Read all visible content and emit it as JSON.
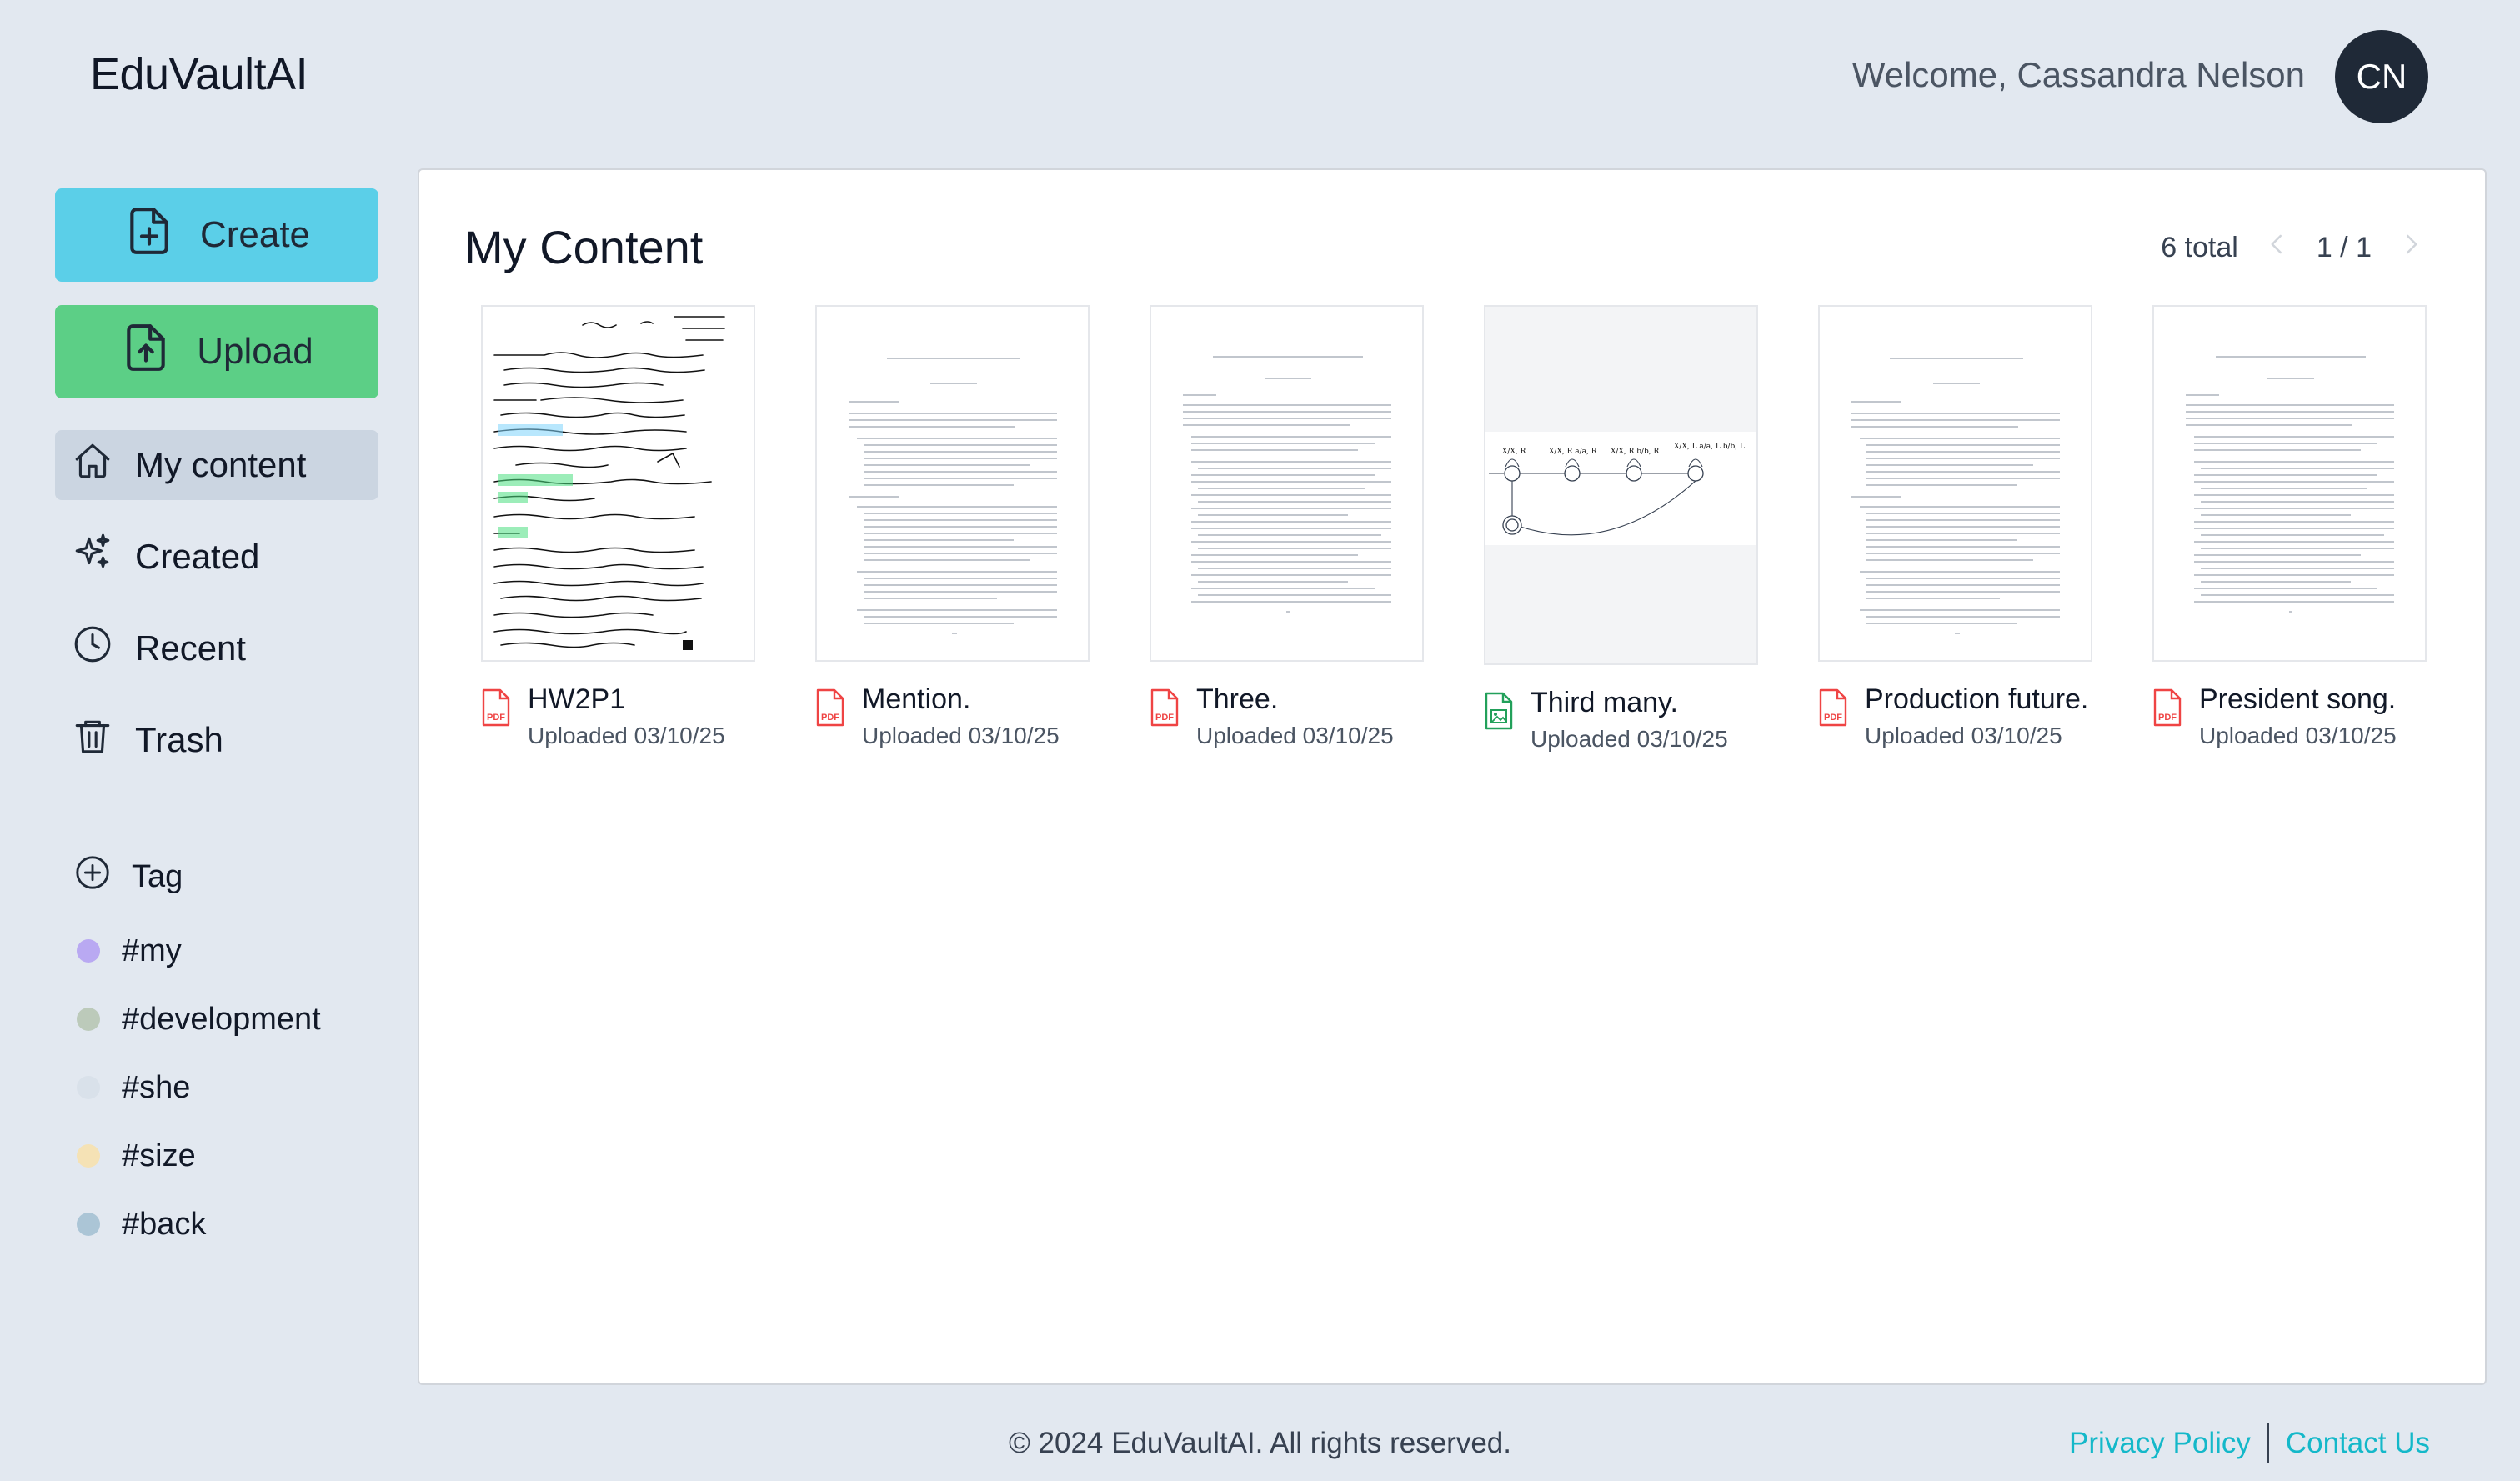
{
  "header": {
    "brand": "EduVaultAI",
    "welcome": "Welcome, Cassandra Nelson",
    "avatar_initials": "CN"
  },
  "sidebar": {
    "create_label": "Create",
    "upload_label": "Upload",
    "nav": [
      {
        "label": "My content",
        "icon": "home-icon",
        "active": true
      },
      {
        "label": "Created",
        "icon": "sparkles-icon",
        "active": false
      },
      {
        "label": "Recent",
        "icon": "clock-icon",
        "active": false
      },
      {
        "label": "Trash",
        "icon": "trash-icon",
        "active": false
      }
    ],
    "tag_header": "Tag",
    "tags": [
      {
        "label": "#my",
        "color": "#b9a9f2"
      },
      {
        "label": "#development",
        "color": "#bccaba"
      },
      {
        "label": "#she",
        "color": "#d9e1ea"
      },
      {
        "label": "#size",
        "color": "#f5e2b5"
      },
      {
        "label": "#back",
        "color": "#abc5d6"
      }
    ]
  },
  "main": {
    "title": "My Content",
    "total": "6 total",
    "page": "1 / 1",
    "items": [
      {
        "name": "HW2P1",
        "date": "Uploaded 03/10/25",
        "type": "pdf"
      },
      {
        "name": "Mention.",
        "date": "Uploaded 03/10/25",
        "type": "pdf"
      },
      {
        "name": "Three.",
        "date": "Uploaded 03/10/25",
        "type": "pdf"
      },
      {
        "name": "Third many.",
        "date": "Uploaded 03/10/25",
        "type": "image"
      },
      {
        "name": "Production future.",
        "date": "Uploaded 03/10/25",
        "type": "pdf"
      },
      {
        "name": "President song.",
        "date": "Uploaded 03/10/25",
        "type": "pdf"
      }
    ]
  },
  "footer": {
    "copyright": "© 2024 EduVaultAI. All rights reserved.",
    "privacy": "Privacy Policy",
    "contact": "Contact Us"
  },
  "colors": {
    "create": "#5bcfe8",
    "upload": "#5ccf86",
    "pdf_icon": "#ef4444",
    "image_icon": "#22a05a",
    "link": "#14b8c9"
  }
}
